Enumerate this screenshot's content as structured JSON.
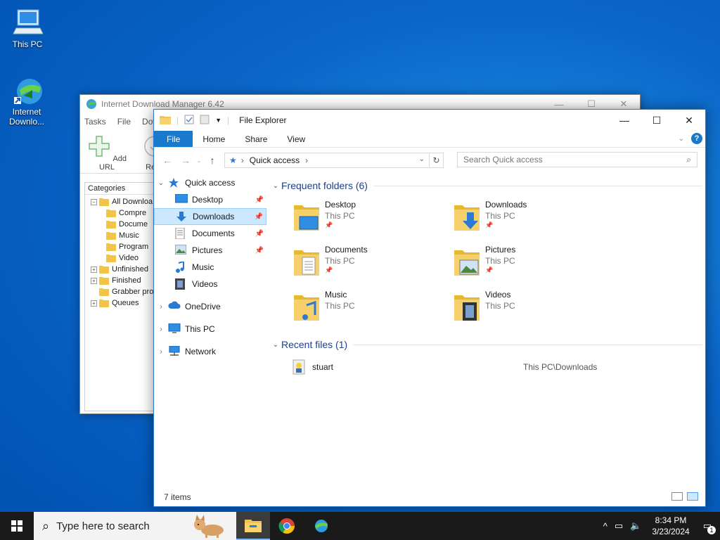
{
  "desktop": {
    "icons": [
      {
        "label": "This PC"
      },
      {
        "label": "Internet Downlo..."
      }
    ]
  },
  "idm": {
    "title": "Internet Download Manager 6.42",
    "menu": [
      "Tasks",
      "File",
      "Dow"
    ],
    "toolbar": {
      "add_url": "Add URL",
      "resume": "Resu"
    },
    "categories_header": "Categories",
    "categories": [
      {
        "label": "All Downloa",
        "indent": 0,
        "exp": "−"
      },
      {
        "label": "Compre",
        "indent": 1
      },
      {
        "label": "Docume",
        "indent": 1
      },
      {
        "label": "Music",
        "indent": 1
      },
      {
        "label": "Program",
        "indent": 1
      },
      {
        "label": "Video",
        "indent": 1
      },
      {
        "label": "Unfinished",
        "indent": 0,
        "exp": "+"
      },
      {
        "label": "Finished",
        "indent": 0,
        "exp": "+"
      },
      {
        "label": "Grabber pro",
        "indent": 0
      },
      {
        "label": "Queues",
        "indent": 0,
        "exp": "+"
      }
    ]
  },
  "explorer": {
    "title": "File Explorer",
    "ribbon_tabs": [
      "File",
      "Home",
      "Share",
      "View"
    ],
    "address": "Quick access",
    "search_placeholder": "Search Quick access",
    "nav": [
      {
        "label": "Quick access",
        "arrow": "v",
        "level": 0,
        "icon": "star-icon"
      },
      {
        "label": "Desktop",
        "level": 1,
        "pinned": true,
        "icon": "desktop-icon"
      },
      {
        "label": "Downloads",
        "level": 1,
        "pinned": true,
        "selected": true,
        "icon": "download-arrow-icon"
      },
      {
        "label": "Documents",
        "level": 1,
        "pinned": true,
        "icon": "document-icon"
      },
      {
        "label": "Pictures",
        "level": 1,
        "pinned": true,
        "icon": "picture-icon"
      },
      {
        "label": "Music",
        "level": 1,
        "icon": "music-note-icon"
      },
      {
        "label": "Videos",
        "level": 1,
        "icon": "film-icon"
      },
      {
        "label": "OneDrive",
        "arrow": ">",
        "level": 0,
        "icon": "cloud-icon"
      },
      {
        "label": "This PC",
        "arrow": ">",
        "level": 0,
        "icon": "computer-icon"
      },
      {
        "label": "Network",
        "arrow": ">",
        "level": 0,
        "icon": "network-icon"
      }
    ],
    "frequent_header": "Frequent folders (6)",
    "folders": [
      {
        "name": "Desktop",
        "location": "This PC",
        "pinned": true,
        "overlay": "desktop"
      },
      {
        "name": "Downloads",
        "location": "This PC",
        "pinned": true,
        "overlay": "download"
      },
      {
        "name": "Documents",
        "location": "This PC",
        "pinned": true,
        "overlay": "document"
      },
      {
        "name": "Pictures",
        "location": "This PC",
        "pinned": true,
        "overlay": "picture"
      },
      {
        "name": "Music",
        "location": "This PC",
        "pinned": false,
        "overlay": "music"
      },
      {
        "name": "Videos",
        "location": "This PC",
        "pinned": false,
        "overlay": "film"
      }
    ],
    "recent_header": "Recent files (1)",
    "recent": [
      {
        "name": "stuart",
        "path": "This PC\\Downloads"
      }
    ],
    "status": "7 items"
  },
  "taskbar": {
    "search_placeholder": "Type here to search",
    "time": "8:34 PM",
    "date": "3/23/2024",
    "notification_count": "1"
  }
}
